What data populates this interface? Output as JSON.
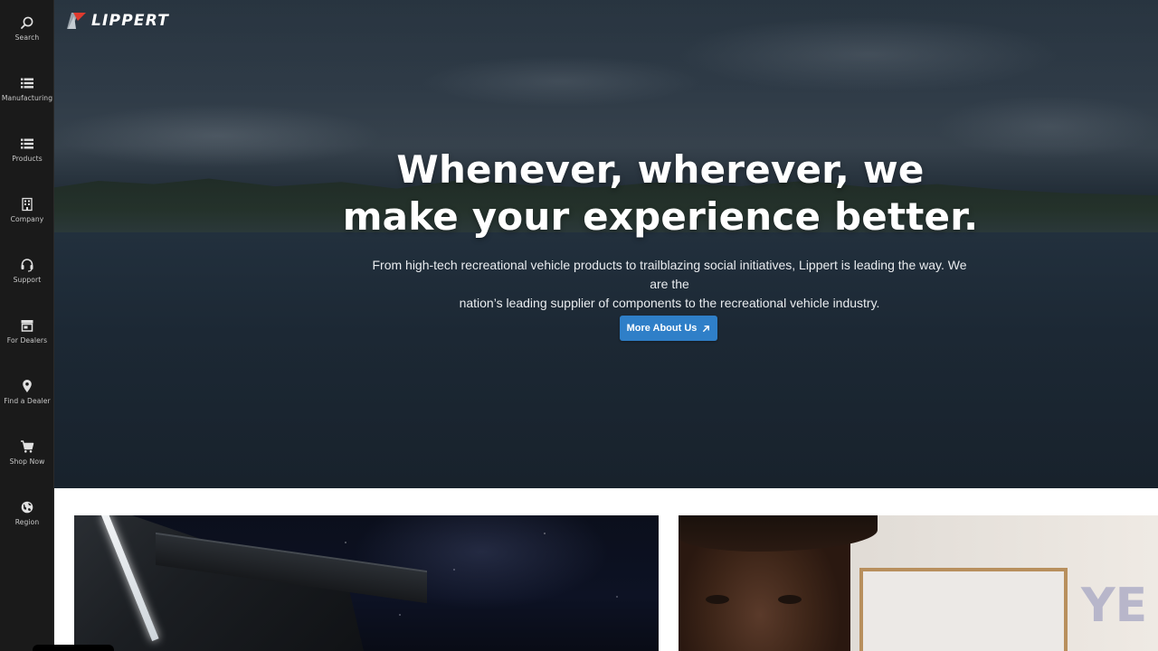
{
  "brand": {
    "name": "LIPPERT",
    "accent": "#e03a2e"
  },
  "sidebar": {
    "items": [
      {
        "label": "Search",
        "icon": "search-icon"
      },
      {
        "label": "Manufacturing",
        "icon": "list-icon"
      },
      {
        "label": "Products",
        "icon": "list-icon"
      },
      {
        "label": "Company",
        "icon": "building-icon"
      },
      {
        "label": "Support",
        "icon": "headset-icon"
      },
      {
        "label": "For Dealers",
        "icon": "store-icon"
      },
      {
        "label": "Find a Dealer",
        "icon": "map-pin-icon"
      },
      {
        "label": "Shop Now",
        "icon": "cart-icon"
      },
      {
        "label": "Region",
        "icon": "globe-icon"
      }
    ]
  },
  "hero": {
    "title_line1": "Whenever, wherever, we",
    "title_line2": "make your experience better.",
    "subtitle_line1": "From high-tech recreational vehicle products to trailblazing social initiatives, Lippert is leading the way. We are the",
    "subtitle_line2": "nation’s leading supplier of components to the recreational vehicle industry.",
    "button_label": "More About Us",
    "button_color": "#2f7fc8"
  },
  "cards": {
    "right_wall_text": "YE"
  }
}
